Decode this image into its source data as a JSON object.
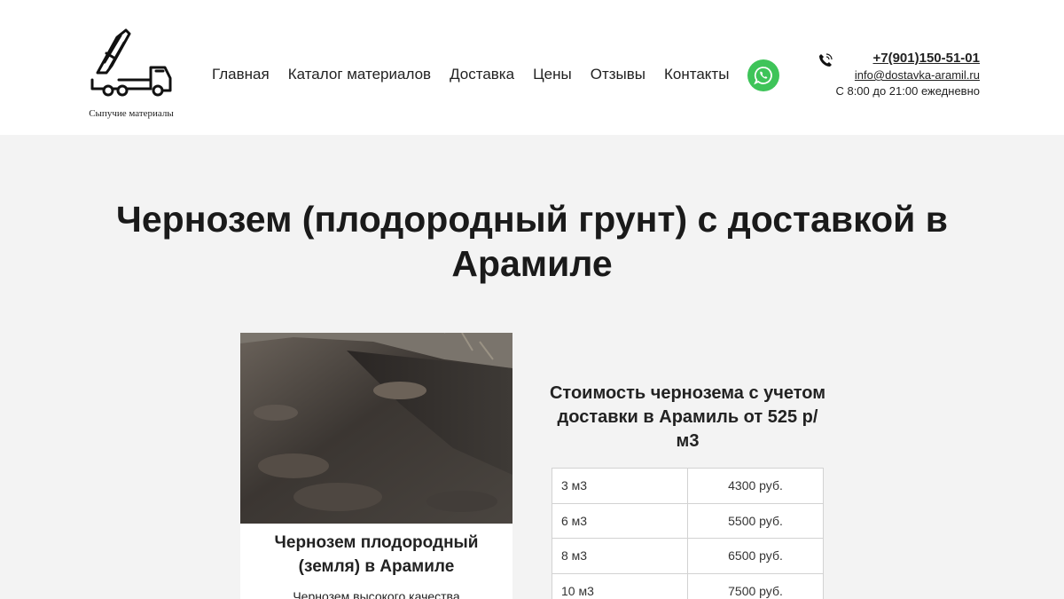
{
  "header": {
    "logo": {
      "icon": "dump-truck-icon",
      "caption": "Сыпучие материалы"
    },
    "nav": [
      "Главная",
      "Каталог материалов",
      "Доставка",
      "Цены",
      "Отзывы",
      "Контакты"
    ],
    "whatsapp": {
      "icon": "whatsapp-icon",
      "color": "#3ec459"
    },
    "contacts": {
      "phone_icon": "phone-icon",
      "phone": "+7(901)150-51-01",
      "email": "info@dostavka-aramil.ru",
      "hours": "С 8:00 до 21:00 ежедневно"
    }
  },
  "page_title": "Чернозем (плодородный грунт) с доставкой в Арамиле",
  "card": {
    "image": "black-soil-photo",
    "title": "Чернозем плодородный (земля) в Арамиле",
    "description": "Чернозем высокого качества"
  },
  "pricing": {
    "heading": "Стоимость чернозема с учетом доставки в Арамиль от 525 р/м3",
    "rows": [
      {
        "volume": "3 м3",
        "price": "4300 руб."
      },
      {
        "volume": "6 м3",
        "price": "5500 руб."
      },
      {
        "volume": "8 м3",
        "price": "6500 руб."
      },
      {
        "volume": "10 м3",
        "price": "7500 руб."
      }
    ]
  }
}
